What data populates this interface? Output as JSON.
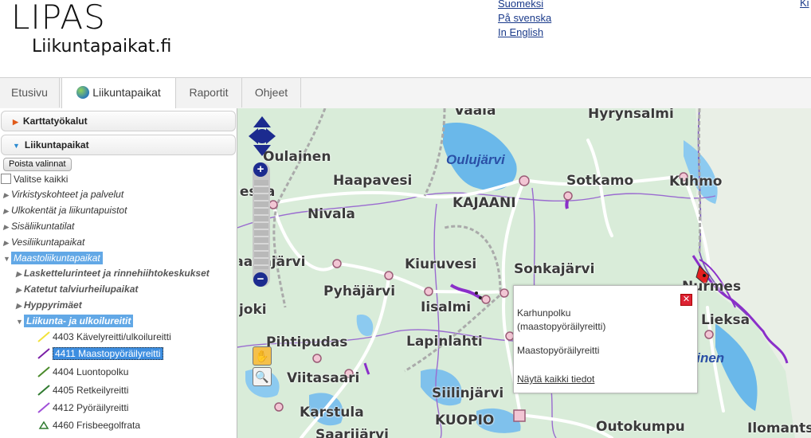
{
  "header": {
    "logo_title": "LIPAS",
    "logo_subtitle": "Liikuntapaikat.fi",
    "languages": [
      "Suomeksi",
      "På svenska",
      "In English"
    ],
    "corner_link": "Ki"
  },
  "tabs": [
    {
      "label": "Etusivu",
      "active": false
    },
    {
      "label": "Liikuntapaikat",
      "active": true
    },
    {
      "label": "Raportit",
      "active": false
    },
    {
      "label": "Ohjeet",
      "active": false
    }
  ],
  "panel": {
    "map_tools": "Karttatyökalut",
    "sports_sites": "Liikuntapaikat",
    "clear_button": "Poista valinnat",
    "select_all": "Valitse kaikki",
    "categories": [
      "Virkistyskohteet ja palvelut",
      "Ulkokentät ja liikuntapuistot",
      "Sisäliikuntatilat",
      "Vesiliikuntapaikat",
      "Maastoliikuntapaikat"
    ],
    "subcategories": [
      "Laskettelurinteet ja rinnehiihtokeskukset",
      "Katetut talviurheilupaikat",
      "Hyppyrimäet",
      "Liikunta- ja ulkoilureitit"
    ],
    "routes": [
      {
        "label": "4403 Kävelyreitti/ulkoilureitti",
        "color": "#f2e23a",
        "symbol": "line"
      },
      {
        "label": "4411 Maastopyöräilyreitti",
        "color": "#7a1fa6",
        "symbol": "line",
        "selected": true
      },
      {
        "label": "4404 Luontopolku",
        "color": "#4a8a2a",
        "symbol": "line"
      },
      {
        "label": "4405 Retkeilyreitti",
        "color": "#2f7a2f",
        "symbol": "line"
      },
      {
        "label": "4412 Pyöräilyreitti",
        "color": "#a050d8",
        "symbol": "line"
      },
      {
        "label": "4460 Frisbeegolfrata",
        "color": "#2f7a2f",
        "symbol": "triangle"
      }
    ]
  },
  "map": {
    "cities": [
      "Vaala",
      "Hyrynsalmi",
      "Oulainen",
      "Haapavesi",
      "Sotkamo",
      "Kuhmo",
      "Ylivieska",
      "Nivala",
      "KAJAANI",
      "Haapajärvi",
      "Kiuruvesi",
      "Sonkajärvi",
      "Pyhäjärvi",
      "Iisalmi",
      "Nurmes",
      "Kalajoki",
      "Lieksa",
      "Pihtipudas",
      "Lapinlahti",
      "Viitasaari",
      "Siilinjärvi",
      "Karstula",
      "KUOPIO",
      "Outokumpu",
      "Saarijärvi",
      "Ilomantsi"
    ],
    "lakes": [
      "Oulujärvi",
      "Pielinen"
    ],
    "pan_icon": "pan-arrows-icon",
    "zoom_in_icon": "plus-icon",
    "zoom_out_icon": "minus-icon",
    "hand_tool_icon": "hand-icon",
    "zoom_box_icon": "zoom-box-icon"
  },
  "popup": {
    "name": "Karhunpolku",
    "name_type": "(maastopyöräilyreitti)",
    "type": "Maastopyöräilyreitti",
    "link": "Näytä kaikki tiedot",
    "close_icon": "close-icon"
  },
  "colors": {
    "route": "#8a2fc9",
    "highlight": "#62a8e6",
    "water": "#6ab8ea",
    "road_primary": "#ffffff",
    "zoom_control": "#1c2b8f"
  }
}
